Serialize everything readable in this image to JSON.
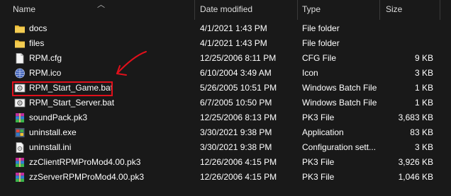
{
  "columns": {
    "name": "Name",
    "date": "Date modified",
    "type": "Type",
    "size": "Size"
  },
  "files": [
    {
      "name": "docs",
      "date": "4/1/2021 1:43 PM",
      "type": "File folder",
      "size": "",
      "icon": "folder-icon"
    },
    {
      "name": "files",
      "date": "4/1/2021 1:43 PM",
      "type": "File folder",
      "size": "",
      "icon": "folder-icon"
    },
    {
      "name": "RPM.cfg",
      "date": "12/25/2006 8:11 PM",
      "type": "CFG File",
      "size": "9 KB",
      "icon": "document-icon"
    },
    {
      "name": "RPM.ico",
      "date": "6/10/2004 3:49 AM",
      "type": "Icon",
      "size": "3 KB",
      "icon": "globe-icon"
    },
    {
      "name": "RPM_Start_Game.bat",
      "date": "5/26/2005 10:51 PM",
      "type": "Windows Batch File",
      "size": "1 KB",
      "icon": "batch-file-icon"
    },
    {
      "name": "RPM_Start_Server.bat",
      "date": "6/7/2005 10:50 PM",
      "type": "Windows Batch File",
      "size": "1 KB",
      "icon": "batch-file-icon"
    },
    {
      "name": "soundPack.pk3",
      "date": "12/25/2006 8:13 PM",
      "type": "PK3 File",
      "size": "3,683 KB",
      "icon": "archive-icon"
    },
    {
      "name": "uninstall.exe",
      "date": "3/30/2021 9:38 PM",
      "type": "Application",
      "size": "83 KB",
      "icon": "installer-icon"
    },
    {
      "name": "uninstall.ini",
      "date": "3/30/2021 9:38 PM",
      "type": "Configuration sett...",
      "size": "3 KB",
      "icon": "settings-file-icon"
    },
    {
      "name": "zzClientRPMProMod4.00.pk3",
      "date": "12/26/2006 4:15 PM",
      "type": "PK3 File",
      "size": "3,926 KB",
      "icon": "archive-icon"
    },
    {
      "name": "zzServerRPMProMod4.00.pk3",
      "date": "12/26/2006 4:15 PM",
      "type": "PK3 File",
      "size": "1,046 KB",
      "icon": "archive-icon"
    }
  ],
  "colors": {
    "background": "#191919",
    "annotation": "#e0101b",
    "folder": "#f0c43a"
  }
}
